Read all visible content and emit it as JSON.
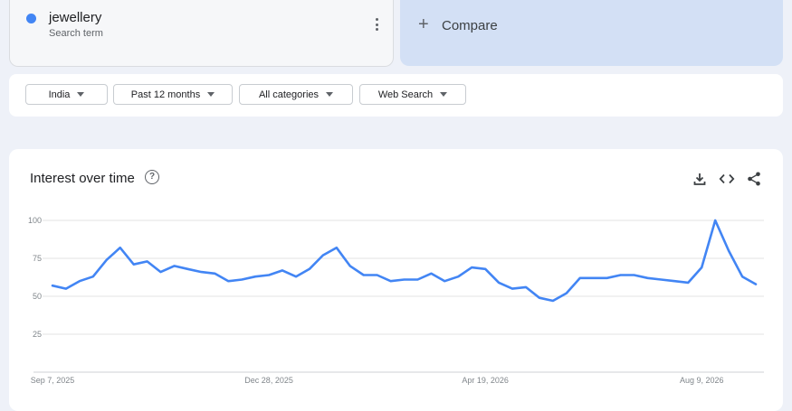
{
  "search_term": {
    "name": "jewellery",
    "subtitle": "Search term",
    "color": "#4285f4"
  },
  "compare": {
    "label": "Compare",
    "icon": "plus-icon"
  },
  "filters": [
    {
      "label": "India"
    },
    {
      "label": "Past 12 months"
    },
    {
      "label": "All categories"
    },
    {
      "label": "Web Search"
    }
  ],
  "chart_header": {
    "title": "Interest over time",
    "icons": [
      "help-icon",
      "download-icon",
      "embed-icon",
      "share-icon"
    ]
  },
  "chart_data": {
    "type": "line",
    "ylim": [
      0,
      100
    ],
    "yticks": [
      25,
      50,
      75,
      100
    ],
    "grid": true,
    "x_labels": [
      "Sep 7, 2025",
      "Dec 28, 2025",
      "Apr 19, 2026",
      "Aug 9, 2026"
    ],
    "series": [
      {
        "color": "#4285f4",
        "values": [
          57,
          55,
          60,
          63,
          74,
          82,
          71,
          73,
          66,
          70,
          68,
          66,
          65,
          60,
          61,
          63,
          64,
          67,
          63,
          68,
          77,
          82,
          70,
          64,
          64,
          60,
          61,
          61,
          65,
          60,
          63,
          69,
          68,
          59,
          55,
          56,
          49,
          47,
          52,
          62,
          62,
          62,
          64,
          64,
          62,
          61,
          60,
          59,
          69,
          100,
          80,
          63,
          58
        ]
      }
    ]
  }
}
